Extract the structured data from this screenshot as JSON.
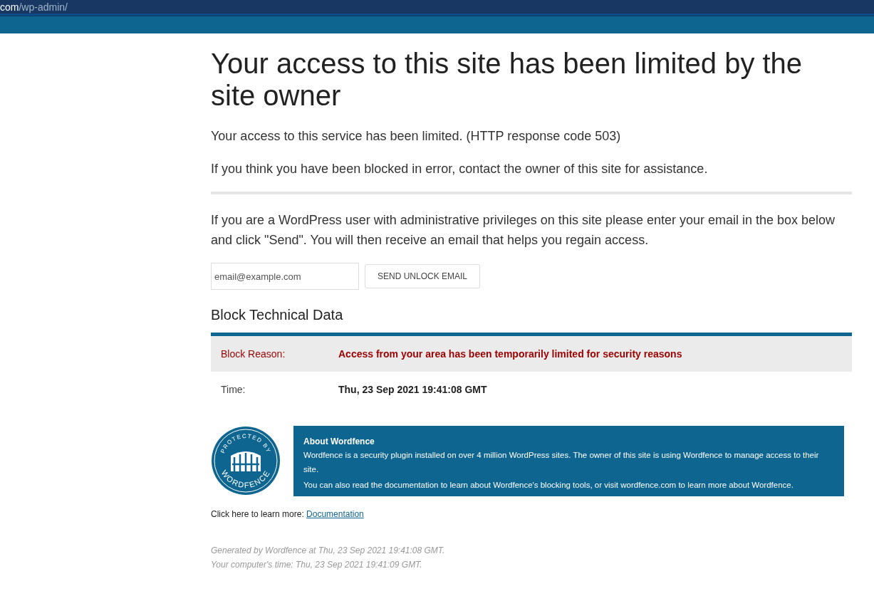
{
  "address_bar": {
    "host_end": "com",
    "path": "/wp-admin/"
  },
  "title": "Your access to this site has been limited by the site owner",
  "messages": [
    "Your access to this service has been limited. (HTTP response code 503)",
    "If you think you have been blocked in error, contact the owner of this site for assistance."
  ],
  "unlock_intro": "If you are a WordPress user with administrative privileges on this site please enter your email in the box below and click \"Send\". You will then receive an email that helps you regain access.",
  "email_field": {
    "placeholder": "email@example.com"
  },
  "unlock_button": "SEND UNLOCK EMAIL",
  "technical_heading": "Block Technical Data",
  "technical_rows": [
    {
      "kind": "reason",
      "label": "Block Reason:",
      "value": "Access from your area has been temporarily limited for security reasons"
    },
    {
      "kind": "plain",
      "label": "Time:",
      "value": "Thu, 23 Sep 2021 19:41:08 GMT"
    }
  ],
  "badge": {
    "top": "PROTECTED BY",
    "bottom": "WORDFENCE"
  },
  "about": {
    "title": "About Wordfence",
    "paragraphs": [
      "Wordfence is a security plugin installed on over 4 million WordPress sites. The owner of this site is using Wordfence to manage access to their site.",
      "You can also read the documentation to learn about Wordfence's blocking tools, or visit wordfence.com to learn more about Wordfence."
    ]
  },
  "learn_more": {
    "text": "Click here to learn more:",
    "link": "Documentation"
  },
  "footer": [
    "Generated by Wordfence at Thu, 23 Sep 2021 19:41:08 GMT.",
    "Your computer's time: Thu, 23 Sep 2021 19:41:09 GMT."
  ]
}
